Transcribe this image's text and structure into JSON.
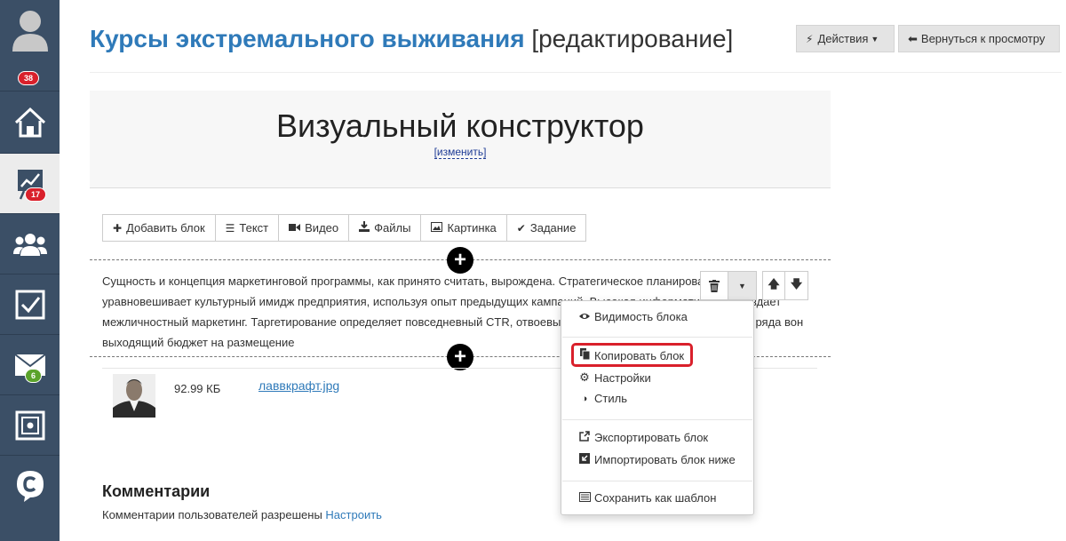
{
  "sidebar": {
    "badges": {
      "profile": "38",
      "stats": "17",
      "mail": "6"
    }
  },
  "header": {
    "title_main": "Курсы экстремального выживания",
    "title_suffix": "[редактирование]",
    "actions_label": "Действия",
    "back_label": "Вернуться к просмотру"
  },
  "constructor": {
    "title": "Визуальный конструктор",
    "change_link": "[изменить]"
  },
  "toolbar": {
    "add_block": "Добавить блок",
    "text": "Текст",
    "video": "Видео",
    "files": "Файлы",
    "image": "Картинка",
    "task": "Задание"
  },
  "content": {
    "paragraph": "Сущность и концепция маркетинговой программы, как принято считать, вырождена. Стратегическое планирование уравновешивает культурный имидж предприятия, используя опыт предыдущих кампаний. Высокая информативность создает межличностный маркетинг. Таргетирование определяет повседневный CTR, отвоевывая рыночный сегмент, искажает из ряда вон выходящий бюджет на размещение"
  },
  "file": {
    "size": "92.99 КБ",
    "name": "лаввкрафт.jpg"
  },
  "comments": {
    "title": "Комментарии",
    "text": "Комментарии пользователей разрешены",
    "link": "Настроить"
  },
  "menu": {
    "visibility": "Видимость блока",
    "copy": "Копировать блок",
    "settings": "Настройки",
    "style": "Стиль",
    "export": "Экспортировать блок",
    "import": "Импортировать блок ниже",
    "save_template": "Сохранить как шаблон"
  },
  "colors": {
    "sidebar_bg": "#3b4f66",
    "accent_blue": "#2f7ab9",
    "badge_red": "#d9202b",
    "badge_green": "#5ba32b",
    "highlight_red": "#d9202b"
  }
}
